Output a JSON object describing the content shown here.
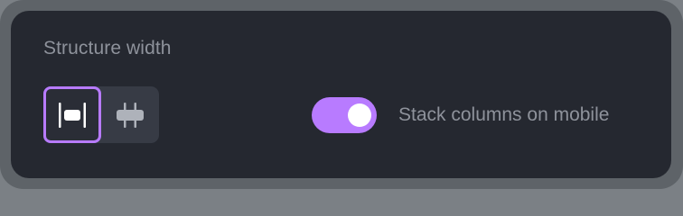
{
  "structure_width": {
    "title": "Structure width",
    "options": [
      {
        "icon": "fixed-width-icon",
        "selected": true
      },
      {
        "icon": "full-width-icon",
        "selected": false
      }
    ]
  },
  "stack_columns": {
    "label": "Stack columns on mobile",
    "enabled": true
  },
  "colors": {
    "accent": "#b87bff",
    "panel": "#252830",
    "text_muted": "#8e929b"
  }
}
